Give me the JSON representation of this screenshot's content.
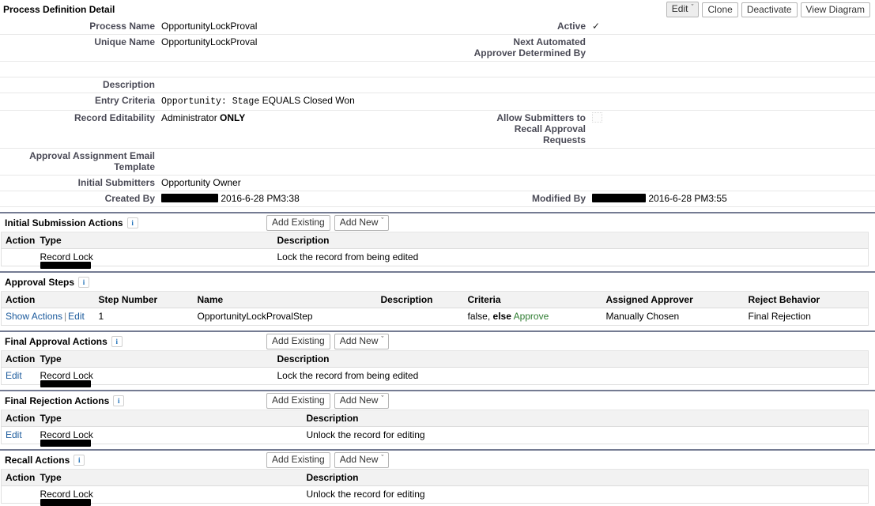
{
  "detail": {
    "title": "Process Definition Detail",
    "buttons": [
      {
        "label": "Edit",
        "caret": "ˇ",
        "style": "gray"
      },
      {
        "label": "Clone",
        "caret": "",
        "style": "plain"
      },
      {
        "label": "Deactivate",
        "caret": "",
        "style": "plain"
      },
      {
        "label": "View Diagram",
        "caret": "",
        "style": "plain"
      }
    ],
    "fields": {
      "process_name_label": "Process Name",
      "process_name_value": "OpportunityLockProval",
      "unique_name_label": "Unique Name",
      "unique_name_value": "OpportunityLockProval",
      "active_label": "Active",
      "active_value": "✓",
      "next_approver_label": "Next Automated Approver Determined By",
      "next_approver_value": "",
      "description_label": "Description",
      "description_value": "",
      "entry_criteria_label": "Entry Criteria",
      "entry_criteria_mono": "Opportunity: Stage",
      "entry_criteria_rest": "EQUALS Closed Won",
      "record_editability_label": "Record Editability",
      "record_editability_value": "Administrator",
      "record_editability_emphasis": "ONLY",
      "allow_recall_label": "Allow Submitters to Recall Approval Requests",
      "allow_recall_checked": false,
      "email_template_label": "Approval Assignment Email Template",
      "email_template_value": "",
      "initial_submitters_label": "Initial Submitters",
      "initial_submitters_value": "Opportunity Owner",
      "created_by_label": "Created By",
      "created_by_value": "2016-6-28 PM3:38",
      "modified_by_label": "Modified By",
      "modified_by_value": "2016-6-28 PM3:55"
    }
  },
  "common": {
    "add_existing": "Add Existing",
    "add_new": "Add New",
    "caret": "ˇ",
    "info_glyph": "i"
  },
  "sections": [
    {
      "id": "initial-submission-actions",
      "title": "Initial Submission Actions",
      "has_buttons": true,
      "columns": [
        "Action",
        "Type",
        "Description"
      ],
      "col_widths": [
        "44px",
        "300px",
        "auto"
      ],
      "rows": [
        {
          "action": "",
          "type": "Record Lock",
          "description": "Lock the record from being edited"
        }
      ]
    },
    {
      "id": "approval-steps",
      "title": "Approval Steps",
      "has_buttons": false,
      "columns": [
        "Action",
        "Step Number",
        "Name",
        "Description",
        "Criteria",
        "Assigned Approver",
        "Reject Behavior"
      ],
      "col_widths": [
        "118px",
        "125px",
        "232px",
        "110px",
        "175px",
        "180px",
        "auto"
      ],
      "rows": [
        {
          "action_show": "Show Actions",
          "action_edit": "Edit",
          "step_number": "1",
          "name": "OpportunityLockProvalStep",
          "description": "",
          "criteria_prefix": "false,",
          "criteria_else": "else",
          "criteria_result": "Approve",
          "assigned_approver": "Manually Chosen",
          "reject_behavior": "Final Rejection"
        }
      ]
    },
    {
      "id": "final-approval-actions",
      "title": "Final Approval Actions",
      "has_buttons": true,
      "columns": [
        "Action",
        "Type",
        "Description"
      ],
      "col_widths": [
        "44px",
        "300px",
        "auto"
      ],
      "rows": [
        {
          "action": "Edit",
          "type": "Record Lock",
          "description": "Lock the record from being edited"
        }
      ]
    },
    {
      "id": "final-rejection-actions",
      "title": "Final Rejection Actions",
      "has_buttons": true,
      "columns": [
        "Action",
        "Type",
        "Description"
      ],
      "col_widths": [
        "44px",
        "337px",
        "auto"
      ],
      "rows": [
        {
          "action": "Edit",
          "type": "Record Lock",
          "description": "Unlock the record for editing"
        }
      ]
    },
    {
      "id": "recall-actions",
      "title": "Recall Actions",
      "has_buttons": true,
      "columns": [
        "Action",
        "Type",
        "Description"
      ],
      "col_widths": [
        "44px",
        "337px",
        "auto"
      ],
      "rows": [
        {
          "action": "",
          "type": "Record Lock",
          "description": "Unlock the record for editing"
        }
      ]
    }
  ]
}
